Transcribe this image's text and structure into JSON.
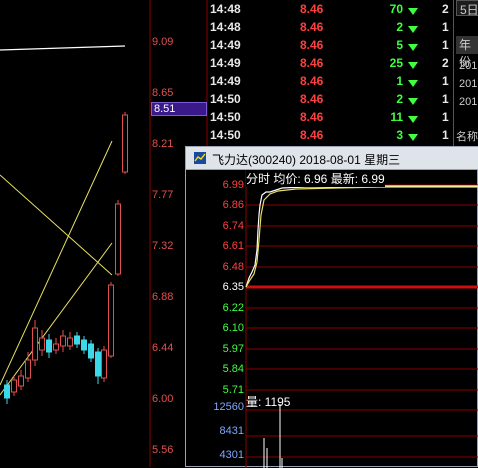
{
  "price_axis": {
    "labels": [
      "9.09",
      "8.65",
      "8.21",
      "7.77",
      "7.32",
      "6.88",
      "6.44",
      "6.00",
      "5.56"
    ],
    "current_price_tag": "8.51"
  },
  "trade_list": [
    {
      "time": "14:48",
      "price": "8.46",
      "volume": "70",
      "extra": "2"
    },
    {
      "time": "14:48",
      "price": "8.46",
      "volume": "2",
      "extra": "1"
    },
    {
      "time": "14:49",
      "price": "8.46",
      "volume": "5",
      "extra": "1"
    },
    {
      "time": "14:49",
      "price": "8.46",
      "volume": "25",
      "extra": "2"
    },
    {
      "time": "14:49",
      "price": "8.46",
      "volume": "1",
      "extra": "1"
    },
    {
      "time": "14:50",
      "price": "8.46",
      "volume": "2",
      "extra": "1"
    },
    {
      "time": "14:50",
      "price": "8.46",
      "volume": "11",
      "extra": "1"
    },
    {
      "time": "14:50",
      "price": "8.46",
      "volume": "3",
      "extra": "1"
    }
  ],
  "right_panel": {
    "tab": "5日",
    "header": "年份",
    "items": [
      "201",
      "201",
      "201"
    ],
    "bottom": "名称"
  },
  "popup": {
    "title": "飞力达(300240) 2018-08-01 星期三",
    "info": "分时 均价: 6.96 最新: 6.99",
    "price_labels": [
      {
        "value": "6.99",
        "color": "#ff4040"
      },
      {
        "value": "6.86",
        "color": "#ff4040"
      },
      {
        "value": "6.74",
        "color": "#ff4040"
      },
      {
        "value": "6.61",
        "color": "#ff4040"
      },
      {
        "value": "6.48",
        "color": "#ff4040"
      },
      {
        "value": "6.35",
        "color": "#ffffff"
      },
      {
        "value": "6.22",
        "color": "#40ff40"
      },
      {
        "value": "6.10",
        "color": "#40ff40"
      },
      {
        "value": "5.97",
        "color": "#40ff40"
      },
      {
        "value": "5.84",
        "color": "#40ff40"
      },
      {
        "value": "5.71",
        "color": "#40ff40"
      }
    ],
    "volume_title": "量: 1195",
    "volume_labels": [
      "12560",
      "8431",
      "4301"
    ]
  },
  "colors": {
    "up": "#ff4040",
    "down": "#40ff40",
    "grid": "#8a0000"
  }
}
